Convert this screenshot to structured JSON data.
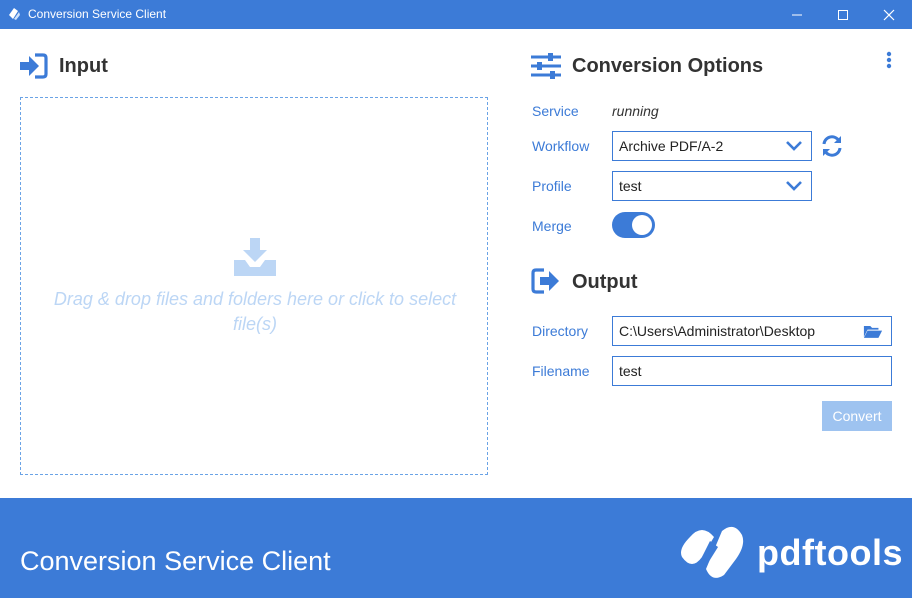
{
  "window": {
    "title": "Conversion Service Client",
    "controls": [
      "minimize-icon",
      "maximize-icon",
      "close-icon"
    ]
  },
  "input": {
    "heading": "Input",
    "icon": "sign-in-icon",
    "dropzone_icon": "download-tray-icon",
    "dropzone_text": "Drag & drop files and folders here or click to select file(s)"
  },
  "options": {
    "heading": "Conversion Options",
    "icon": "sliders-icon",
    "menu_icon": "vertical-ellipsis-icon",
    "service_label": "Service",
    "service_value": "running",
    "workflow_label": "Workflow",
    "workflow_value": "Archive PDF/A-2",
    "profile_label": "Profile",
    "profile_value": "test",
    "merge_label": "Merge",
    "merge_on": true
  },
  "output": {
    "heading": "Output",
    "icon": "sign-out-icon",
    "directory_label": "Directory",
    "directory_value": "C:\\Users\\Administrator\\Desktop",
    "filename_label": "Filename",
    "filename_value": "test",
    "convert_label": "Convert"
  },
  "footer": {
    "title": "Conversion Service Client",
    "brand": "pdftools"
  },
  "colors": {
    "accent": "#3c7bd7",
    "accent_light": "#9ec3f0",
    "dropzone_text": "#bcd6f5",
    "background": "#ffffff"
  }
}
